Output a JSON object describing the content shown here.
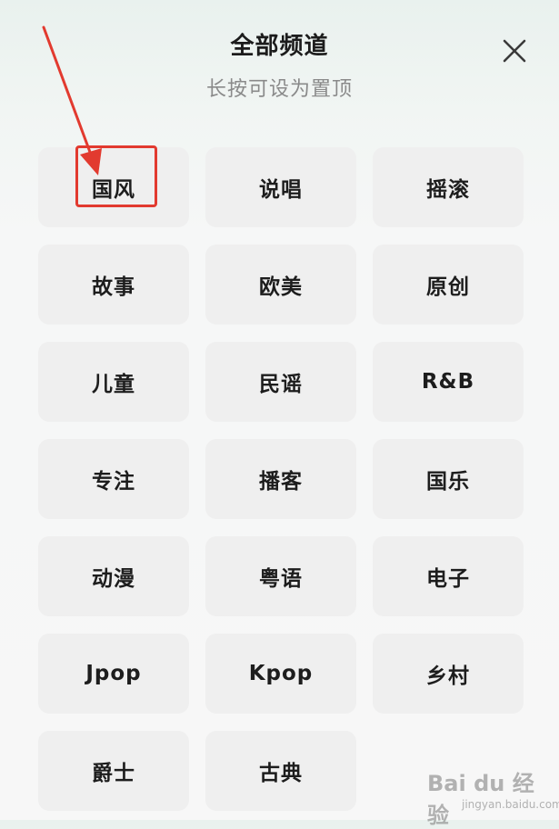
{
  "header": {
    "title": "全部频道",
    "subtitle": "长按可设为置顶"
  },
  "channels": [
    {
      "label": "国风"
    },
    {
      "label": "说唱"
    },
    {
      "label": "摇滚"
    },
    {
      "label": "故事"
    },
    {
      "label": "欧美"
    },
    {
      "label": "原创"
    },
    {
      "label": "儿童"
    },
    {
      "label": "民谣"
    },
    {
      "label": "R&B"
    },
    {
      "label": "专注"
    },
    {
      "label": "播客"
    },
    {
      "label": "国乐"
    },
    {
      "label": "动漫"
    },
    {
      "label": "粤语"
    },
    {
      "label": "电子"
    },
    {
      "label": "Jpop"
    },
    {
      "label": "Kpop"
    },
    {
      "label": "乡村"
    },
    {
      "label": "爵士"
    },
    {
      "label": "古典"
    }
  ],
  "icons": {
    "close": "close-icon",
    "annotation_arrow": "arrow-icon"
  },
  "colors": {
    "annotation_red": "#e23a2f",
    "chip_bg": "#efefef"
  },
  "watermark": {
    "brand": "Bai du 经验",
    "url": "jingyan.baidu.com"
  }
}
